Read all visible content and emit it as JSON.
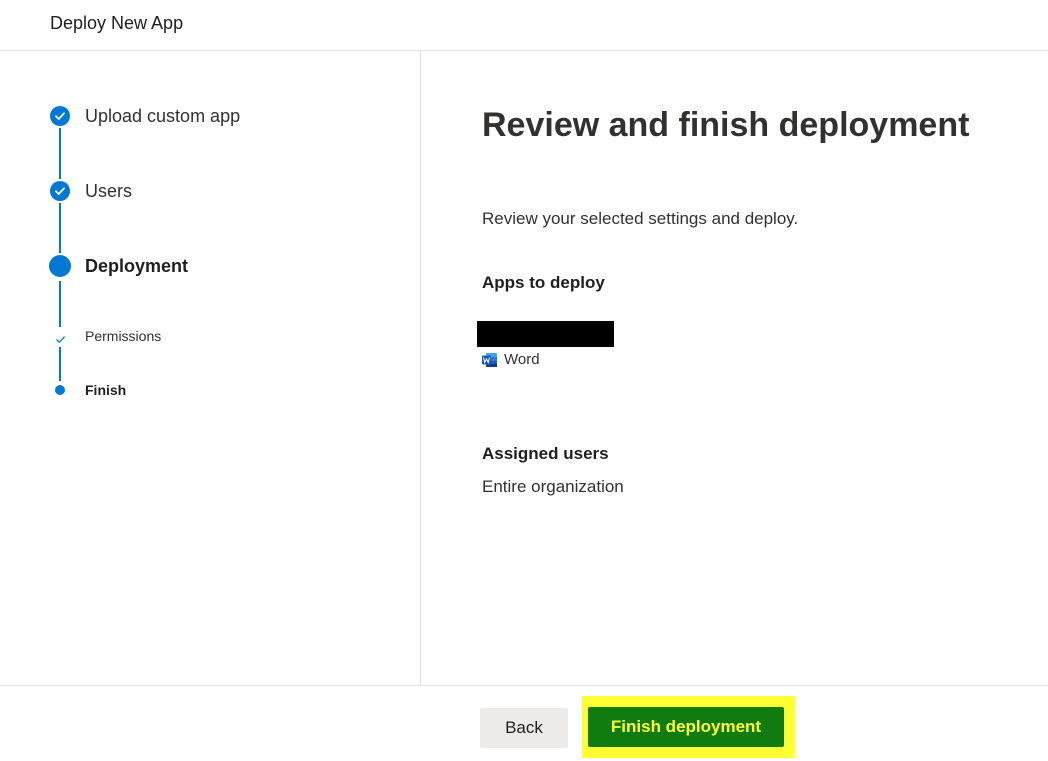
{
  "header": {
    "title": "Deploy New App"
  },
  "stepper": {
    "steps": [
      {
        "label": "Upload custom app",
        "state": "completed"
      },
      {
        "label": "Users",
        "state": "completed"
      },
      {
        "label": "Deployment",
        "state": "current"
      }
    ],
    "substeps": [
      {
        "label": "Permissions",
        "state": "completed"
      },
      {
        "label": "Finish",
        "state": "current"
      }
    ]
  },
  "main": {
    "title": "Review and finish deployment",
    "description": "Review your selected settings and deploy.",
    "apps_heading": "Apps to deploy",
    "app": {
      "icon": "word-icon",
      "name": "Word"
    },
    "users_heading": "Assigned users",
    "users_value": "Entire organization"
  },
  "footer": {
    "back_label": "Back",
    "finish_label": "Finish deployment"
  },
  "colors": {
    "accent": "#0078d4",
    "primary_button": "#107c10",
    "highlight": "#ffff33",
    "word_blue": "#185abd"
  }
}
